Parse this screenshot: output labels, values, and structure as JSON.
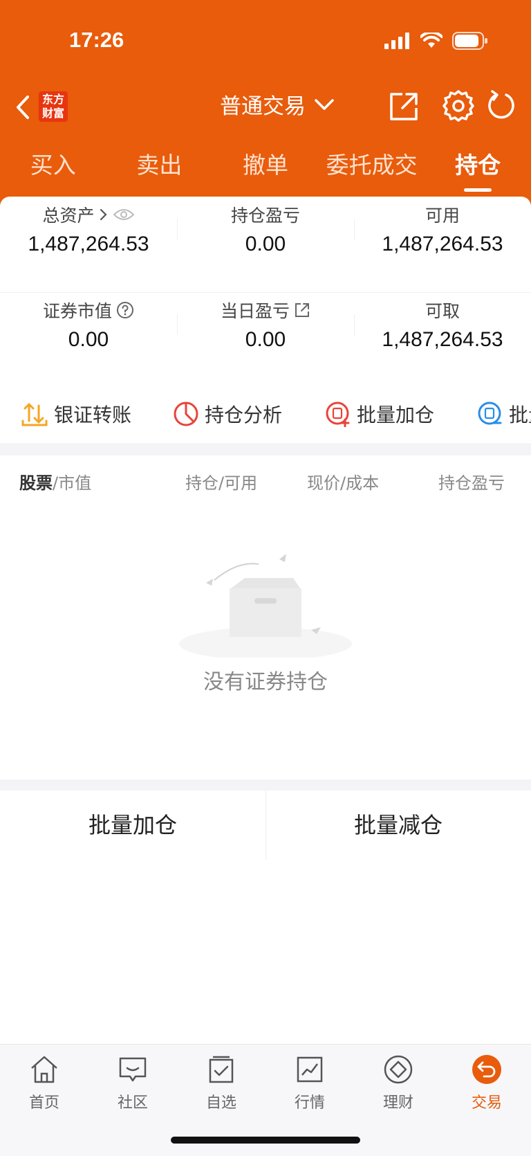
{
  "status_bar": {
    "time": "17:26"
  },
  "header": {
    "logo_line1": "东方",
    "logo_line2": "财富",
    "title": "普通交易"
  },
  "tabs": [
    {
      "label": "买入"
    },
    {
      "label": "卖出"
    },
    {
      "label": "撤单"
    },
    {
      "label": "委托成交"
    },
    {
      "label": "持仓",
      "active": true
    }
  ],
  "summary": {
    "total_assets_label": "总资产",
    "total_assets_value": "1,487,264.53",
    "position_pl_label": "持仓盈亏",
    "position_pl_value": "0.00",
    "available_label": "可用",
    "available_value": "1,487,264.53",
    "market_value_label": "证券市值",
    "market_value_value": "0.00",
    "daily_pl_label": "当日盈亏",
    "daily_pl_value": "0.00",
    "withdrawable_label": "可取",
    "withdrawable_value": "1,487,264.53"
  },
  "quick_actions": [
    {
      "label": "银证转账",
      "icon": "transfer-icon"
    },
    {
      "label": "持仓分析",
      "icon": "pie-chart-icon"
    },
    {
      "label": "批量加仓",
      "icon": "batch-add-icon"
    },
    {
      "label": "批量",
      "icon": "batch-reduce-icon"
    }
  ],
  "table_header": {
    "col1_main": "股票",
    "col1_sub": "/市值",
    "col2": "持仓/可用",
    "col3": "现价/成本",
    "col4": "持仓盈亏"
  },
  "empty_state": {
    "text": "没有证券持仓"
  },
  "batch": {
    "add_label": "批量加仓",
    "reduce_label": "批量减仓"
  },
  "tabbar": [
    {
      "label": "首页",
      "icon": "home-icon"
    },
    {
      "label": "社区",
      "icon": "community-icon"
    },
    {
      "label": "自选",
      "icon": "watchlist-icon"
    },
    {
      "label": "行情",
      "icon": "market-icon"
    },
    {
      "label": "理财",
      "icon": "wealth-icon"
    },
    {
      "label": "交易",
      "icon": "trade-icon",
      "active": true
    }
  ],
  "colors": {
    "brand": "#e85c0c",
    "accent_red": "#e8350f"
  }
}
